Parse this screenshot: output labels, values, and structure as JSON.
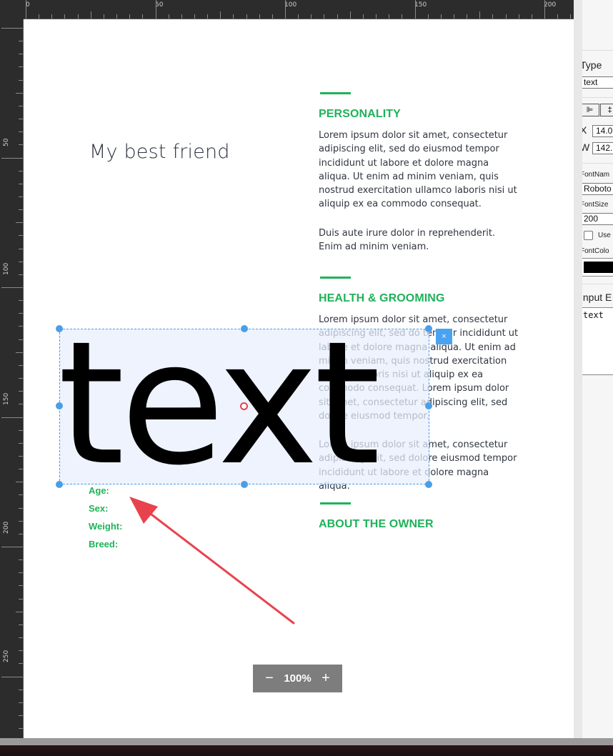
{
  "ruler": {
    "h_labels": [
      "0",
      "50",
      "100",
      "150",
      "200"
    ],
    "v_labels": [
      "50",
      "100",
      "150",
      "200",
      "250"
    ]
  },
  "document": {
    "title": "My best friend",
    "personality": {
      "heading": "PERSONALITY",
      "paragraph1": "Lorem ipsum dolor sit amet, consectetur adipiscing elit, sed do eiusmod tempor incididunt ut labore et dolore magna aliqua. Ut enim ad minim veniam, quis nostrud exercitation ullamco laboris nisi ut aliquip ex ea commodo consequat.",
      "paragraph2": "Duis aute irure dolor in reprehenderit. Enim ad minim veniam."
    },
    "health": {
      "heading": "HEALTH & GROOMING",
      "paragraph1": "Lorem ipsum dolor sit amet, consectetur adipiscing elit, sed do tempor incididunt ut labore et dolore magna aliqua. Ut enim ad minim veniam, quis nostrud exercitation ullamco laboris nisi ut aliquip ex ea commodo consequat. Lorem ipsum dolor sit amet, consectetur adipiscing elit, sed dolore eiusmod tempor.",
      "paragraph2": "Lorem ipsum dolor sit amet, consectetur adipiscing elit, sed dolore eiusmod tempor incididunt ut labore et dolore magna aliqua."
    },
    "owner": {
      "heading": "ABOUT THE OWNER"
    },
    "pet_fields": [
      "Age:",
      "Sex:",
      "Weight:",
      "Breed:"
    ]
  },
  "selected_element": {
    "text": "text",
    "delete_glyph": "×"
  },
  "zoom": {
    "minus": "−",
    "level": "100%",
    "plus": "+"
  },
  "panel": {
    "type_label": "Type",
    "type_value": "text",
    "align_left_glyph": "⊫",
    "align_center_glyph": "‡",
    "x_label": "X",
    "x_value": "14.0",
    "w_label": "W",
    "w_value": "142.",
    "font_name_label": "FontNam",
    "font_name_value": "Roboto",
    "font_size_label": "FontSize",
    "font_size_value": "200",
    "use_label": "Use",
    "font_color_label": "FontColo",
    "font_color_value": "#000000",
    "input_label": "Input E",
    "input_value": "text"
  },
  "colors": {
    "accent": "#1fb25a",
    "selection": "#4a9ee8",
    "arrow": "#e8434c"
  }
}
